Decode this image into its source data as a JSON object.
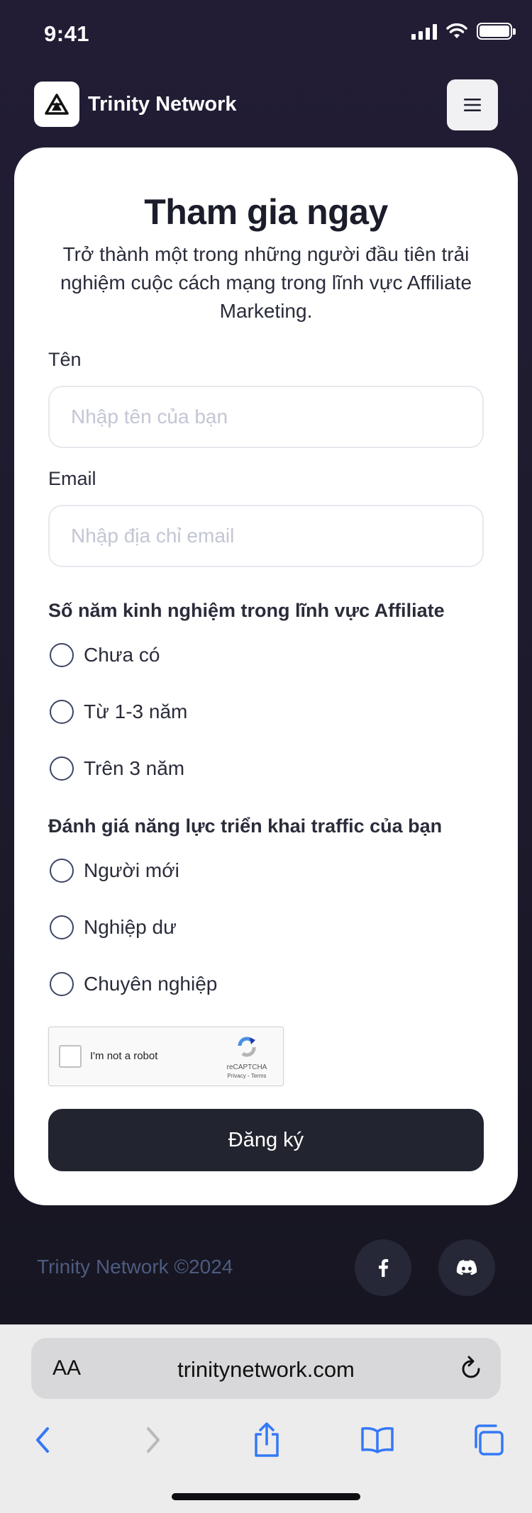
{
  "status_bar": {
    "time": "9:41"
  },
  "header": {
    "brand": "Trinity Network",
    "logo_icon": "trinity-logo-icon",
    "menu_icon": "hamburger-menu-icon"
  },
  "form": {
    "title": "Tham gia ngay",
    "subtitle": "Trở thành một trong những người đầu tiên trải nghiệm cuộc cách mạng trong lĩnh vực Affiliate Marketing.",
    "name_label": "Tên",
    "name_placeholder": "Nhập tên của bạn",
    "name_value": "",
    "email_label": "Email",
    "email_placeholder": "Nhập địa chỉ email",
    "email_value": "",
    "experience": {
      "title": "Số năm kinh nghiệm trong lĩnh vực Affiliate",
      "options": [
        "Chưa có",
        "Từ 1-3 năm",
        "Trên 3 năm"
      ]
    },
    "traffic": {
      "title": "Đánh giá năng lực triển khai traffic của bạn",
      "options": [
        "Người mới",
        "Nghiệp dư",
        "Chuyên nghiệp"
      ]
    },
    "recaptcha": {
      "label": "I'm not a robot",
      "brand": "reCAPTCHA",
      "terms": "Privacy - Terms"
    },
    "submit_label": "Đăng ký"
  },
  "footer": {
    "copyright": "Trinity Network ©2024",
    "social": [
      "facebook-icon",
      "discord-icon"
    ]
  },
  "browser": {
    "aa_label": "AA",
    "url": "trinitynetwork.com"
  },
  "colors": {
    "background": "#1c1a2b",
    "card": "#ffffff",
    "button": "#22242f",
    "footer_text": "#4d5c80",
    "safari_blue": "#3478f6"
  }
}
